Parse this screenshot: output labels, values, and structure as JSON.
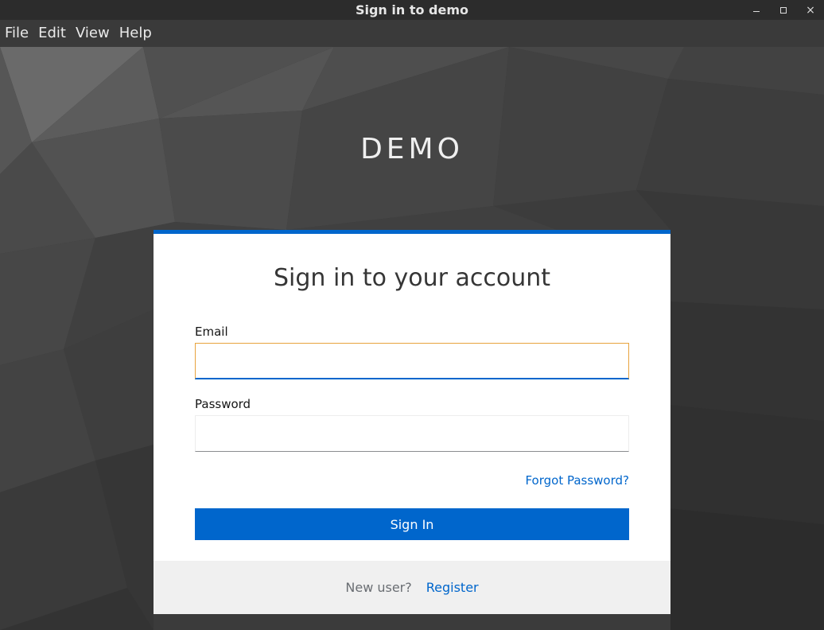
{
  "window": {
    "title": "Sign in to demo",
    "controls": {
      "minimize": "minimize",
      "maximize": "maximize",
      "close": "×"
    }
  },
  "menu": {
    "items": [
      "File",
      "Edit",
      "View",
      "Help"
    ]
  },
  "brand": {
    "name": "DEMO"
  },
  "login": {
    "title": "Sign in to your account",
    "email_label": "Email",
    "email_value": "",
    "password_label": "Password",
    "password_value": "",
    "forgot_password": "Forgot Password?",
    "sign_in_label": "Sign In",
    "new_user_text": "New user?",
    "register_link": "Register"
  },
  "colors": {
    "accent": "#0066cc",
    "focus_border": "#e8a33d",
    "background": "#3a3a3a",
    "card": "#ffffff",
    "footer": "#f0f0f0"
  }
}
